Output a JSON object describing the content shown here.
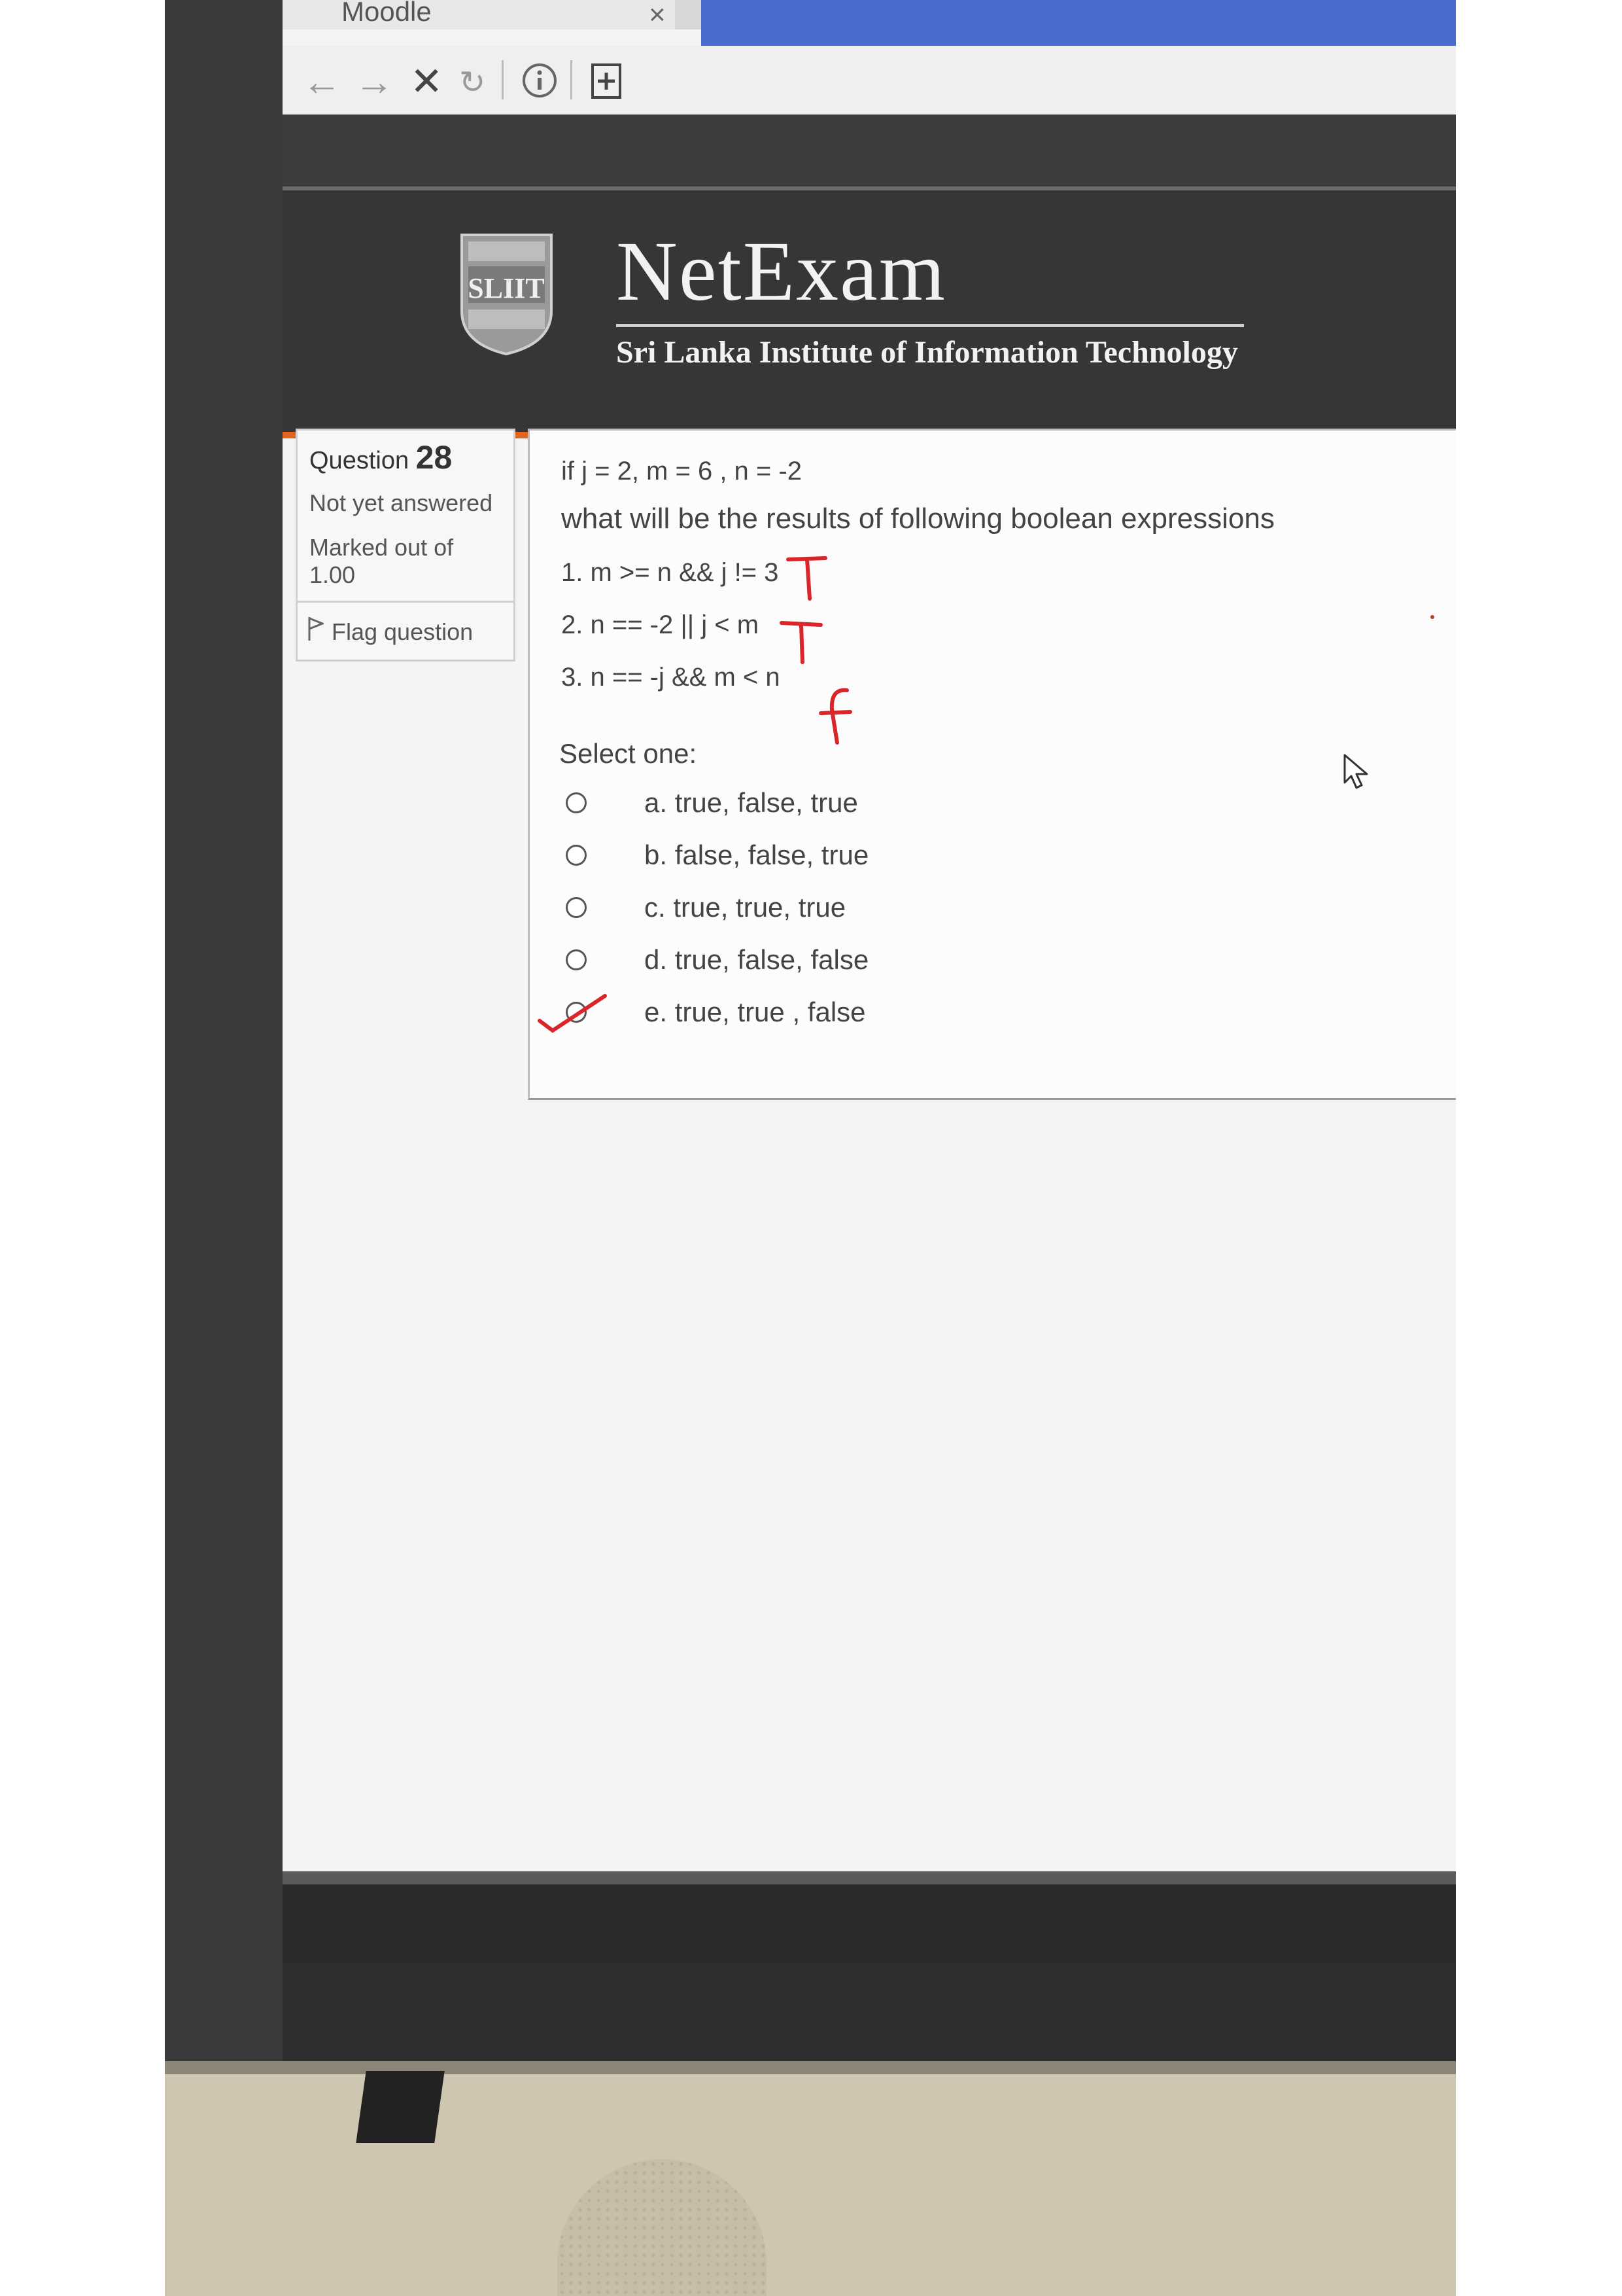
{
  "browser": {
    "tab_title": "Moodle",
    "tab_close": "×",
    "nav_icons": [
      "back-arrow-icon",
      "forward-arrow-icon",
      "stop-icon",
      "reload-icon",
      "info-icon",
      "bookmark-icon"
    ]
  },
  "header": {
    "logo_text": "SLIIT",
    "brand": "NetExam",
    "subtitle": "Sri Lanka Institute of Information Technology",
    "accent_color": "#e0651e"
  },
  "question_info": {
    "label": "Question",
    "number": "28",
    "status": "Not yet answered",
    "marked_label": "Marked out of",
    "marked_value": "1.00",
    "flag_label": "Flag question"
  },
  "question": {
    "given": "if j = 2, m = 6 , n = -2",
    "prompt": "what will be the results of following boolean expressions",
    "expressions": [
      "1. m >= n && j != 3",
      "2. n == -2 || j < m",
      "3. n == -j &&  m < n"
    ],
    "select_label": "Select one:",
    "options": [
      "a. true, false, true",
      "b. false, false, true",
      "c. true, true, true",
      "d. true, false, false",
      "e. true, true , false"
    ],
    "selected_option": null
  },
  "handwriting": {
    "annotations": [
      "T",
      "T",
      "f"
    ],
    "checkmark_on_option": "e",
    "ink_color": "#d9262a"
  }
}
